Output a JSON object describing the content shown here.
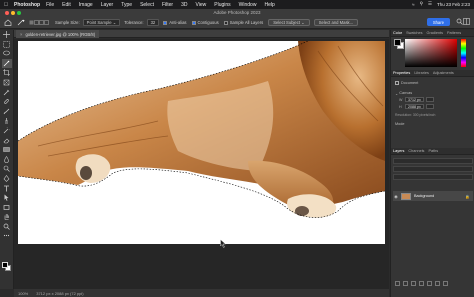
{
  "menubar": {
    "app_name": "Photoshop",
    "menus": [
      "File",
      "Edit",
      "Image",
      "Layer",
      "Type",
      "Select",
      "Filter",
      "3D",
      "View",
      "Plugins",
      "Window",
      "Help"
    ],
    "clock": "Thu 23 Feb  2:23"
  },
  "window": {
    "title": "Adobe Photoshop 2023"
  },
  "options_bar": {
    "sample_size_label": "Sample Size:",
    "sample_size_value": "Point Sample",
    "tolerance_label": "Tolerance:",
    "tolerance_value": "32",
    "anti_alias_label": "Anti-alias",
    "contiguous_label": "Contiguous",
    "sample_all_layers_label": "Sample All Layers",
    "select_subject_label": "Select Subject",
    "select_and_mask_label": "Select and Mask...",
    "share_label": "Share"
  },
  "document": {
    "tab_title": "golden-retriever.jpg @ 100% (RGB/8)",
    "status_zoom": "100%",
    "status_info": "3712 px x 2088 px (72 ppi)"
  },
  "panels": {
    "color_tabs": [
      "Color",
      "Swatches",
      "Gradients",
      "Patterns"
    ],
    "props_tabs": [
      "Properties",
      "Libraries",
      "Adjustments"
    ],
    "props_document_label": "Document",
    "canvas_label": "Canvas",
    "width_label": "W",
    "width_value": "3712 px",
    "height_label": "H",
    "height_value": "2088 px",
    "resolution_label": "Resolution: 300 pixels/inch",
    "mode_label": "Mode",
    "layers_tabs": [
      "Layers",
      "Channels",
      "Paths"
    ],
    "background_layer_name": "Background"
  },
  "colors": {
    "accent_blue": "#2f6fe8",
    "foreground": "#000000",
    "background": "#ffffff"
  }
}
